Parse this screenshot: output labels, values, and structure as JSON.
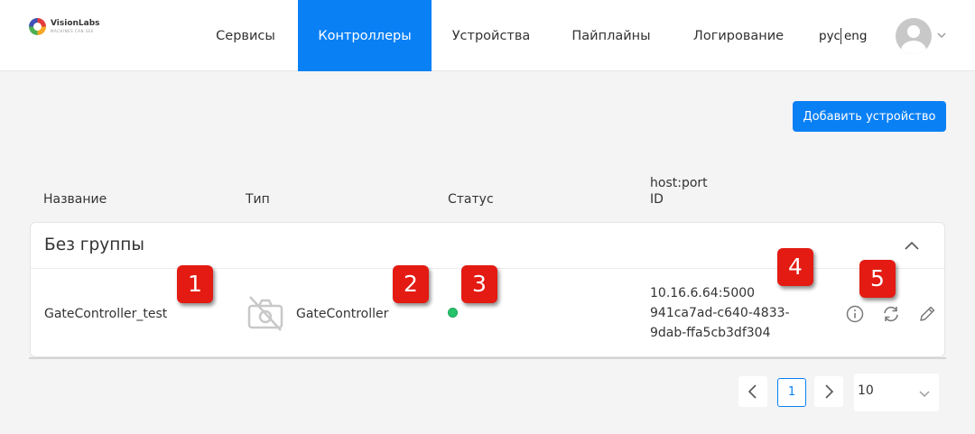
{
  "brand": {
    "name": "VisionLabs",
    "tagline": "MACHINES CAN SEE"
  },
  "nav": {
    "items": [
      {
        "label": "Сервисы",
        "active": false
      },
      {
        "label": "Контроллеры",
        "active": true
      },
      {
        "label": "Устройства",
        "active": false
      },
      {
        "label": "Пайплайны",
        "active": false
      },
      {
        "label": "Логирование",
        "active": false
      }
    ]
  },
  "lang": {
    "ru": "рус",
    "en": "eng"
  },
  "toolbar": {
    "add_label": "Добавить устройство"
  },
  "columns": {
    "name": "Название",
    "type": "Тип",
    "status": "Статус",
    "host": "host:port",
    "id": "ID"
  },
  "group": {
    "title": "Без группы",
    "rows": [
      {
        "name": "GateController_test",
        "type": "GateController",
        "status": "online",
        "host": "10.16.6.64:5000",
        "id_line1": "941ca7ad-c640-4833-",
        "id_line2": "9dab-ffa5cb3df304"
      }
    ]
  },
  "badges": [
    "1",
    "2",
    "3",
    "4",
    "5"
  ],
  "pagination": {
    "current": "1",
    "page_size": "10"
  },
  "colors": {
    "accent": "#0a80f5",
    "status_online": "#27c26a",
    "badge": "#e31b13"
  },
  "icons": [
    "camera-off-icon",
    "info-icon",
    "refresh-icon",
    "edit-icon",
    "chevron-up-icon",
    "chevron-down-icon",
    "chevron-left-icon",
    "chevron-right-icon",
    "user-icon"
  ]
}
